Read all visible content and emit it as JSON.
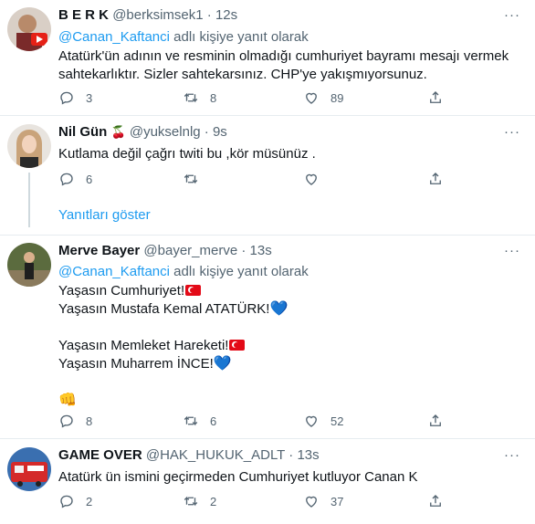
{
  "tweets": [
    {
      "name": "B E R K",
      "handle": "@berksimsek1",
      "time": "12s",
      "reply_mention": "@Canan_Kaftanci",
      "reply_suffix": " adlı kişiye yanıt olarak",
      "text": "Atatürk'ün adının ve resminin olmadığı cumhuriyet bayramı mesajı vermek sahtekarlıktır. Sizler sahtekarsınız. CHP'ye yakışmıyorsunuz.",
      "replies": "3",
      "retweets": "8",
      "likes": "89"
    },
    {
      "name": "Nil Gün",
      "name_emoji": "🍒",
      "handle": "@yukselnlg",
      "time": "9s",
      "text": "Kutlama değil çağrı twiti bu ,kör müsünüz .",
      "replies": "6",
      "retweets": "",
      "likes": ""
    },
    {
      "name": "Merve Bayer",
      "handle": "@bayer_merve",
      "time": "13s",
      "reply_mention": "@Canan_Kaftanci",
      "reply_suffix": " adlı kişiye yanıt olarak",
      "line1": "Yaşasın Cumhuriyet!",
      "line2": "Yaşasın Mustafa Kemal ATATÜRK!",
      "line3": "Yaşasın Memleket Hareketi!",
      "line4": "Yaşasın Muharrem İNCE!",
      "emoji_fist": "👊",
      "emoji_heart": "💙",
      "replies": "8",
      "retweets": "6",
      "likes": "52"
    },
    {
      "name": "GAME OVER",
      "handle": "@HAK_HUKUK_ADLT",
      "time": "13s",
      "text": "Atatürk ün ismini geçirmeden Cumhuriyet kutluyor Canan K",
      "replies": "2",
      "retweets": "2",
      "likes": "37"
    }
  ],
  "show_replies": "Yanıtları göster",
  "dot": "·",
  "more": "···",
  "colors": {
    "accent": "#1d9bf0",
    "muted": "#536471",
    "divider": "#e6ecf0"
  },
  "icons": [
    "reply-icon",
    "retweet-icon",
    "like-icon",
    "share-icon",
    "more-icon"
  ]
}
